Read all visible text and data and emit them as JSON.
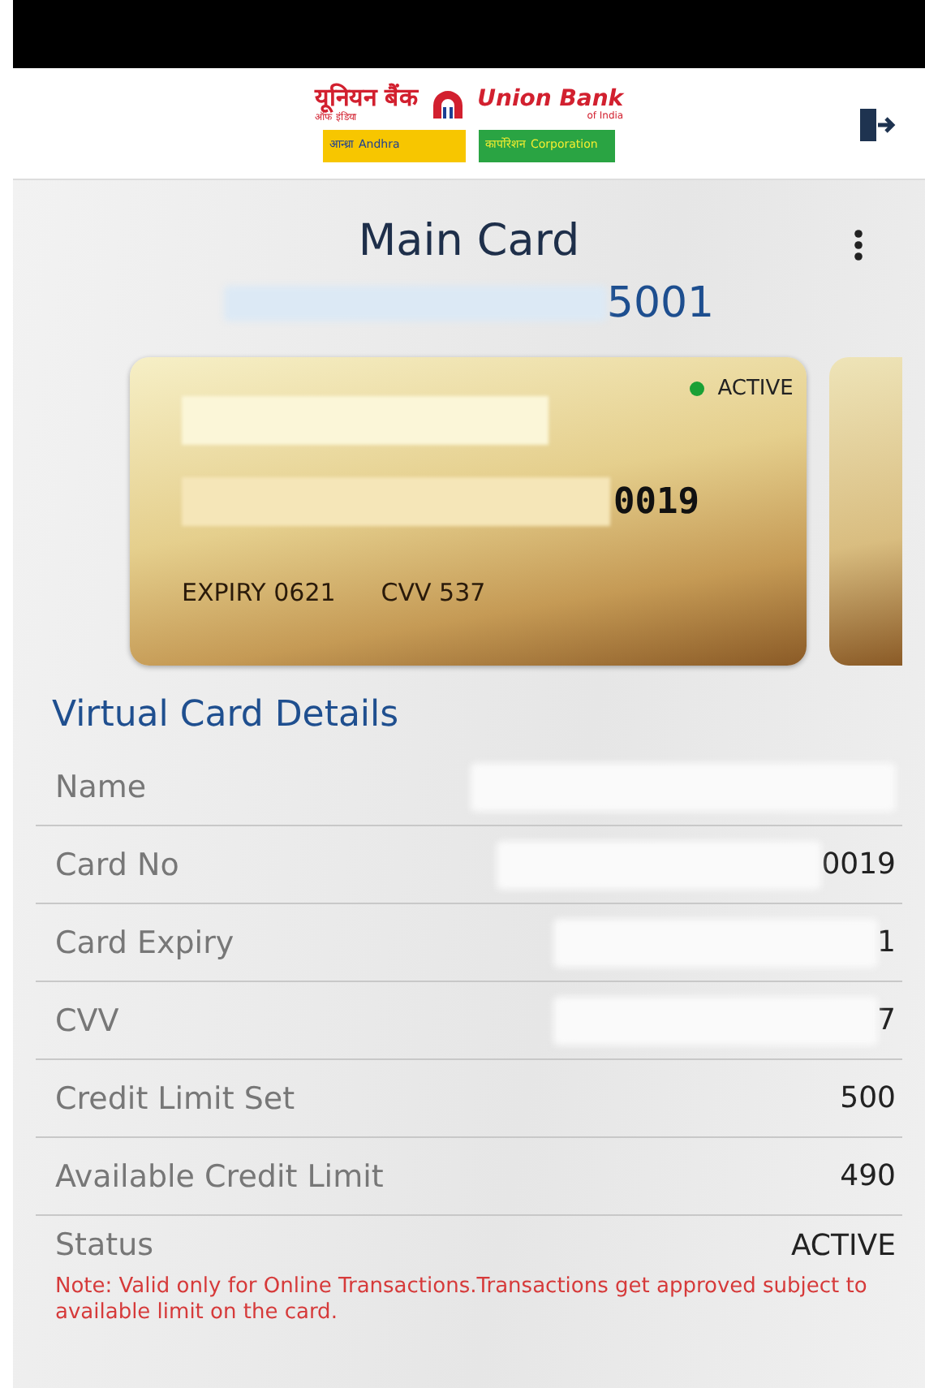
{
  "header": {
    "logo": {
      "hindi_name": "यूनियन बैंक",
      "hindi_sub": "ऑफ इंडिया",
      "name": "Union Bank",
      "sub": "of India",
      "partners": [
        {
          "hindi": "आन्ध्रा",
          "name": "Andhra",
          "kind": "andhra"
        },
        {
          "hindi": "कार्पोरेशन",
          "name": "Corporation",
          "kind": "corporation"
        }
      ]
    }
  },
  "title": "Main Card",
  "account": {
    "masked": true,
    "suffix": "5001"
  },
  "card": {
    "status": "ACTIVE",
    "color": "#1aa035",
    "name_masked": true,
    "number_masked": true,
    "number_suffix": "0019",
    "expiry": "EXPIRY 0621",
    "cvv": "CVV 537"
  },
  "section_title": "Virtual Card Details",
  "details": [
    {
      "label": "Name",
      "masked": true
    },
    {
      "label": "Card No",
      "masked": true,
      "value": "0019"
    },
    {
      "label": "Card Expiry",
      "masked": true,
      "value": "1"
    },
    {
      "label": "CVV",
      "masked": true,
      "value": "7"
    },
    {
      "label": "Credit Limit Set",
      "masked": false,
      "value": "500"
    },
    {
      "label": "Available Credit Limit",
      "masked": false,
      "value": "490"
    },
    {
      "label": "Status",
      "masked": false,
      "value": "ACTIVE"
    }
  ],
  "note": "Note: Valid only for Online Transactions.Transactions get approved subject to available limit on the card."
}
